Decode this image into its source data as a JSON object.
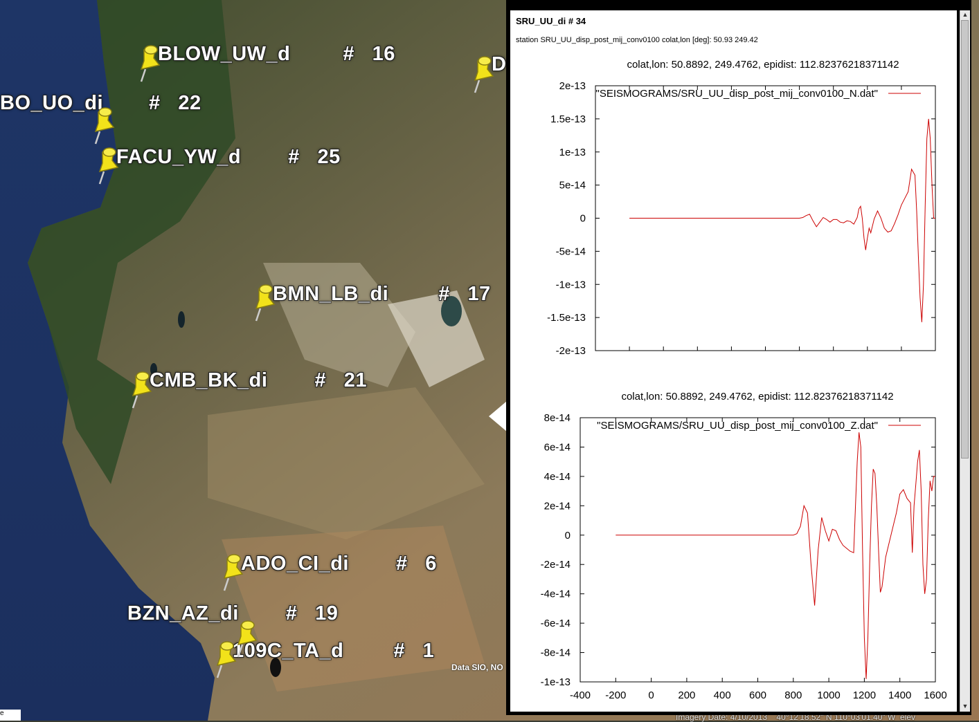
{
  "window": {
    "title": "SRU_UU_di # 34",
    "subtitle": "station SRU_UU_disp_post_mij_conv0100 colat,lon [deg]: 50.93 249.42"
  },
  "map": {
    "credit": "Data SIO, NO",
    "status": "Imagery Date: 4/10/2013    40°12'18.52\" N 110°03'01.40\" W  elev",
    "corner_text": "e",
    "markers": [
      {
        "label": "BLOW_UW_d",
        "num": "#   16"
      },
      {
        "label": "BO_UO_di",
        "num": "#   22"
      },
      {
        "label": "FACU_YW_d",
        "num": "#   25"
      },
      {
        "label": "BMN_LB_di",
        "num": "#   17"
      },
      {
        "label": "CMB_BK_di",
        "num": "#   21"
      },
      {
        "label": "ADO_CI_di",
        "num": "#   6"
      },
      {
        "label": "BZN_AZ_di",
        "num": "#   19"
      },
      {
        "label": "109C_TA_d",
        "num": "#   1"
      },
      {
        "label": "D",
        "num": ""
      }
    ]
  },
  "colors": {
    "trace": "#cc0000",
    "pin": "#f2e21a"
  },
  "chart_data": [
    {
      "type": "line",
      "title": "colat,lon: 50.8892, 249.4762, epidist: 112.82376218371142",
      "legend": "\"SEISMOGRAMS/SRU_UU_disp_post_mij_conv0100_N.dat\"",
      "xlim": [
        -400,
        1600
      ],
      "ylim": [
        -2e-13,
        2e-13
      ],
      "xticks": [
        "-400",
        "-200",
        "0",
        "200",
        "400",
        "600",
        "800",
        "1000",
        "1200",
        "1400",
        "1600"
      ],
      "yticks": [
        "-2e-13",
        "-1.5e-13",
        "-1e-13",
        "-5e-14",
        "0",
        "5e-14",
        "1e-13",
        "1.5e-13",
        "2e-13"
      ],
      "x": [
        -200,
        800,
        820,
        840,
        860,
        880,
        900,
        920,
        940,
        960,
        980,
        1000,
        1020,
        1040,
        1060,
        1080,
        1100,
        1120,
        1140,
        1150,
        1160,
        1170,
        1180,
        1190,
        1200,
        1210,
        1220,
        1240,
        1260,
        1280,
        1300,
        1320,
        1340,
        1360,
        1380,
        1400,
        1420,
        1440,
        1460,
        1480,
        1490,
        1500,
        1510,
        1520,
        1530,
        1540,
        1550,
        1560,
        1570,
        1580,
        1590,
        1600
      ],
      "y": [
        0,
        0,
        1e-15,
        4e-15,
        6e-15,
        -4e-15,
        -1.3e-14,
        -6e-15,
        1e-15,
        -2e-15,
        -6e-15,
        -2e-15,
        -2e-15,
        -6e-15,
        -7e-15,
        -4e-15,
        -5e-15,
        -9e-15,
        1e-15,
        1.4e-14,
        1.8e-14,
        0,
        -3e-14,
        -4.8e-14,
        -3e-14,
        -1.5e-14,
        -2.2e-14,
        -1e-15,
        1.1e-14,
        0,
        -1.5e-14,
        -2.1e-14,
        -1.9e-14,
        -8e-15,
        5e-15,
        2e-14,
        3e-14,
        4e-14,
        7.4e-14,
        6.5e-14,
        1e-14,
        -6e-14,
        -1.2e-13,
        -1.57e-13,
        -1e-13,
        2e-14,
        1.2e-13,
        1.5e-13,
        1.2e-13,
        5e-14,
        0,
        0
      ]
    },
    {
      "type": "line",
      "title": "colat,lon: 50.8892, 249.4762, epidist: 112.82376218371142",
      "legend": "\"SEISMOGRAMS/SRU_UU_disp_post_mij_conv0100_Z.dat\"",
      "xlim": [
        -400,
        1600
      ],
      "ylim": [
        -1e-13,
        8e-14
      ],
      "xticks": [
        "-400",
        "-200",
        "0",
        "200",
        "400",
        "600",
        "800",
        "1000",
        "1200",
        "1400",
        "1600"
      ],
      "yticks": [
        "-1e-13",
        "-8e-14",
        "-6e-14",
        "-4e-14",
        "-2e-14",
        "0",
        "2e-14",
        "4e-14",
        "6e-14",
        "8e-14"
      ],
      "x": [
        -200,
        800,
        820,
        840,
        860,
        880,
        900,
        920,
        940,
        960,
        980,
        1000,
        1020,
        1040,
        1060,
        1080,
        1100,
        1120,
        1140,
        1150,
        1160,
        1170,
        1180,
        1190,
        1200,
        1210,
        1220,
        1230,
        1240,
        1250,
        1260,
        1270,
        1280,
        1290,
        1300,
        1320,
        1340,
        1360,
        1380,
        1400,
        1420,
        1440,
        1460,
        1470,
        1480,
        1490,
        1500,
        1510,
        1520,
        1530,
        1540,
        1550,
        1560,
        1570,
        1580,
        1590,
        1600
      ],
      "y": [
        0,
        0,
        1e-15,
        6e-15,
        2e-14,
        1.5e-14,
        -2e-14,
        -4.8e-14,
        -1e-14,
        1.2e-14,
        3e-15,
        -4e-15,
        4e-15,
        3e-15,
        -3e-15,
        -7e-15,
        -9e-15,
        -1.1e-14,
        -1.2e-14,
        2e-14,
        5e-14,
        7e-14,
        6e-14,
        -1e-14,
        -7e-14,
        -9.8e-14,
        -7e-14,
        -2e-14,
        2e-14,
        4.5e-14,
        4.2e-14,
        2e-14,
        -1e-14,
        -3.9e-14,
        -3.5e-14,
        -1.5e-14,
        -5e-15,
        5e-15,
        1.5e-14,
        2.8e-14,
        3.1e-14,
        2.5e-14,
        2.2e-14,
        -1.2e-14,
        2e-14,
        3.5e-14,
        5e-14,
        5.8e-14,
        3e-14,
        -2e-14,
        -4e-14,
        -3e-14,
        1e-14,
        3.7e-14,
        3e-14,
        4e-14,
        4e-14
      ]
    }
  ]
}
